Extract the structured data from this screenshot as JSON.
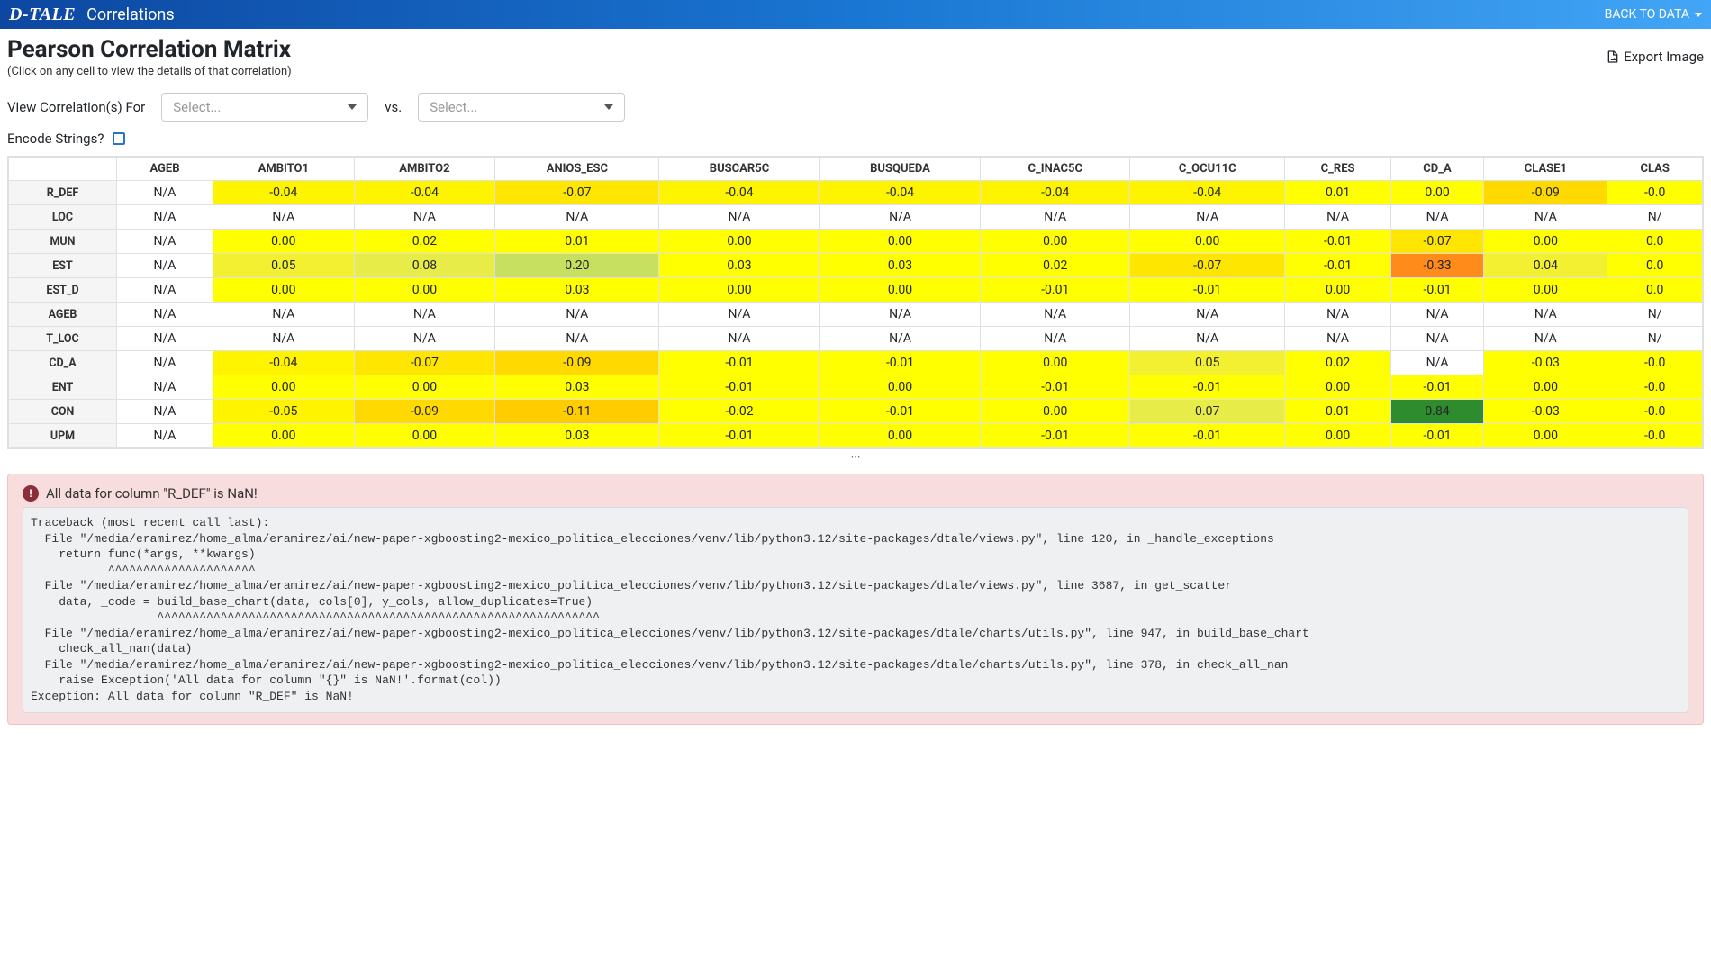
{
  "nav": {
    "logo": "D-TALE",
    "title": "Correlations",
    "back": "BACK TO DATA"
  },
  "header": {
    "title": "Pearson Correlation Matrix",
    "subtitle": "(Click on any cell to view the details of that correlation)",
    "export": "Export Image"
  },
  "controls": {
    "view_label": "View Correlation(s) For",
    "select1_placeholder": "Select...",
    "vs_label": "vs.",
    "select2_placeholder": "Select...",
    "encode_label": "Encode Strings?"
  },
  "table": {
    "col_headers": [
      "AGEB",
      "AMBITO1",
      "AMBITO2",
      "ANIOS_ESC",
      "BUSCAR5C",
      "BUSQUEDA",
      "C_INAC5C",
      "C_OCU11C",
      "C_RES",
      "CD_A",
      "CLASE1",
      "CLAS"
    ],
    "row_headers": [
      "R_DEF",
      "LOC",
      "MUN",
      "EST",
      "EST_D",
      "AGEB",
      "T_LOC",
      "CD_A",
      "ENT",
      "CON",
      "UPM"
    ],
    "cells": [
      [
        {
          "v": "N/A"
        },
        {
          "v": "-0.04"
        },
        {
          "v": "-0.04"
        },
        {
          "v": "-0.07"
        },
        {
          "v": "-0.04"
        },
        {
          "v": "-0.04"
        },
        {
          "v": "-0.04"
        },
        {
          "v": "-0.04"
        },
        {
          "v": "0.01"
        },
        {
          "v": "0.00"
        },
        {
          "v": "-0.09"
        },
        {
          "v": "-0.0"
        }
      ],
      [
        {
          "v": "N/A"
        },
        {
          "v": "N/A"
        },
        {
          "v": "N/A"
        },
        {
          "v": "N/A"
        },
        {
          "v": "N/A"
        },
        {
          "v": "N/A"
        },
        {
          "v": "N/A"
        },
        {
          "v": "N/A"
        },
        {
          "v": "N/A"
        },
        {
          "v": "N/A"
        },
        {
          "v": "N/A"
        },
        {
          "v": "N/"
        }
      ],
      [
        {
          "v": "N/A"
        },
        {
          "v": "0.00"
        },
        {
          "v": "0.02"
        },
        {
          "v": "0.01"
        },
        {
          "v": "0.00"
        },
        {
          "v": "0.00"
        },
        {
          "v": "0.00"
        },
        {
          "v": "0.00"
        },
        {
          "v": "-0.01"
        },
        {
          "v": "-0.07"
        },
        {
          "v": "0.00"
        },
        {
          "v": "0.0"
        }
      ],
      [
        {
          "v": "N/A"
        },
        {
          "v": "0.05"
        },
        {
          "v": "0.08"
        },
        {
          "v": "0.20"
        },
        {
          "v": "0.03"
        },
        {
          "v": "0.03"
        },
        {
          "v": "0.02"
        },
        {
          "v": "-0.07"
        },
        {
          "v": "-0.01"
        },
        {
          "v": "-0.33"
        },
        {
          "v": "0.04"
        },
        {
          "v": "0.0"
        }
      ],
      [
        {
          "v": "N/A"
        },
        {
          "v": "0.00"
        },
        {
          "v": "0.00"
        },
        {
          "v": "0.03"
        },
        {
          "v": "0.00"
        },
        {
          "v": "0.00"
        },
        {
          "v": "-0.01"
        },
        {
          "v": "-0.01"
        },
        {
          "v": "0.00"
        },
        {
          "v": "-0.01"
        },
        {
          "v": "0.00"
        },
        {
          "v": "0.0"
        }
      ],
      [
        {
          "v": "N/A"
        },
        {
          "v": "N/A"
        },
        {
          "v": "N/A"
        },
        {
          "v": "N/A"
        },
        {
          "v": "N/A"
        },
        {
          "v": "N/A"
        },
        {
          "v": "N/A"
        },
        {
          "v": "N/A"
        },
        {
          "v": "N/A"
        },
        {
          "v": "N/A"
        },
        {
          "v": "N/A"
        },
        {
          "v": "N/"
        }
      ],
      [
        {
          "v": "N/A"
        },
        {
          "v": "N/A"
        },
        {
          "v": "N/A"
        },
        {
          "v": "N/A"
        },
        {
          "v": "N/A"
        },
        {
          "v": "N/A"
        },
        {
          "v": "N/A"
        },
        {
          "v": "N/A"
        },
        {
          "v": "N/A"
        },
        {
          "v": "N/A"
        },
        {
          "v": "N/A"
        },
        {
          "v": "N/"
        }
      ],
      [
        {
          "v": "N/A"
        },
        {
          "v": "-0.04"
        },
        {
          "v": "-0.07"
        },
        {
          "v": "-0.09"
        },
        {
          "v": "-0.01"
        },
        {
          "v": "-0.01"
        },
        {
          "v": "0.00"
        },
        {
          "v": "0.05"
        },
        {
          "v": "0.02"
        },
        {
          "v": "N/A"
        },
        {
          "v": "-0.03"
        },
        {
          "v": "-0.0"
        }
      ],
      [
        {
          "v": "N/A"
        },
        {
          "v": "0.00"
        },
        {
          "v": "0.00"
        },
        {
          "v": "0.03"
        },
        {
          "v": "-0.01"
        },
        {
          "v": "0.00"
        },
        {
          "v": "-0.01"
        },
        {
          "v": "-0.01"
        },
        {
          "v": "0.00"
        },
        {
          "v": "-0.01"
        },
        {
          "v": "0.00"
        },
        {
          "v": "-0.0"
        }
      ],
      [
        {
          "v": "N/A"
        },
        {
          "v": "-0.05"
        },
        {
          "v": "-0.09"
        },
        {
          "v": "-0.11"
        },
        {
          "v": "-0.02"
        },
        {
          "v": "-0.01"
        },
        {
          "v": "0.00"
        },
        {
          "v": "0.07"
        },
        {
          "v": "0.01"
        },
        {
          "v": "0.84"
        },
        {
          "v": "-0.03"
        },
        {
          "v": "-0.0"
        }
      ],
      [
        {
          "v": "N/A"
        },
        {
          "v": "0.00"
        },
        {
          "v": "0.00"
        },
        {
          "v": "0.03"
        },
        {
          "v": "-0.01"
        },
        {
          "v": "0.00"
        },
        {
          "v": "-0.01"
        },
        {
          "v": "-0.01"
        },
        {
          "v": "0.00"
        },
        {
          "v": "-0.01"
        },
        {
          "v": "0.00"
        },
        {
          "v": "-0.0"
        }
      ]
    ]
  },
  "error": {
    "title": "All data for column \"R_DEF\" is NaN!",
    "traceback": "Traceback (most recent call last):\n  File \"/media/eramirez/home_alma/eramirez/ai/new-paper-xgboosting2-mexico_politica_elecciones/venv/lib/python3.12/site-packages/dtale/views.py\", line 120, in _handle_exceptions\n    return func(*args, **kwargs)\n           ^^^^^^^^^^^^^^^^^^^^^\n  File \"/media/eramirez/home_alma/eramirez/ai/new-paper-xgboosting2-mexico_politica_elecciones/venv/lib/python3.12/site-packages/dtale/views.py\", line 3687, in get_scatter\n    data, _code = build_base_chart(data, cols[0], y_cols, allow_duplicates=True)\n                  ^^^^^^^^^^^^^^^^^^^^^^^^^^^^^^^^^^^^^^^^^^^^^^^^^^^^^^^^^^^^^^^\n  File \"/media/eramirez/home_alma/eramirez/ai/new-paper-xgboosting2-mexico_politica_elecciones/venv/lib/python3.12/site-packages/dtale/charts/utils.py\", line 947, in build_base_chart\n    check_all_nan(data)\n  File \"/media/eramirez/home_alma/eramirez/ai/new-paper-xgboosting2-mexico_politica_elecciones/venv/lib/python3.12/site-packages/dtale/charts/utils.py\", line 378, in check_all_nan\n    raise Exception('All data for column \"{}\" is NaN!'.format(col))\nException: All data for column \"R_DEF\" is NaN!"
  },
  "chart_data": {
    "type": "heatmap",
    "title": "Pearson Correlation Matrix",
    "row_labels": [
      "R_DEF",
      "LOC",
      "MUN",
      "EST",
      "EST_D",
      "AGEB",
      "T_LOC",
      "CD_A",
      "ENT",
      "CON",
      "UPM"
    ],
    "col_labels": [
      "AGEB",
      "AMBITO1",
      "AMBITO2",
      "ANIOS_ESC",
      "BUSCAR5C",
      "BUSQUEDA",
      "C_INAC5C",
      "C_OCU11C",
      "C_RES",
      "CD_A",
      "CLASE1"
    ],
    "matrix": [
      [
        null,
        -0.04,
        -0.04,
        -0.07,
        -0.04,
        -0.04,
        -0.04,
        -0.04,
        0.01,
        0.0,
        -0.09
      ],
      [
        null,
        null,
        null,
        null,
        null,
        null,
        null,
        null,
        null,
        null,
        null
      ],
      [
        null,
        0.0,
        0.02,
        0.01,
        0.0,
        0.0,
        0.0,
        0.0,
        -0.01,
        -0.07,
        0.0
      ],
      [
        null,
        0.05,
        0.08,
        0.2,
        0.03,
        0.03,
        0.02,
        -0.07,
        -0.01,
        -0.33,
        0.04
      ],
      [
        null,
        0.0,
        0.0,
        0.03,
        0.0,
        0.0,
        -0.01,
        -0.01,
        0.0,
        -0.01,
        0.0
      ],
      [
        null,
        null,
        null,
        null,
        null,
        null,
        null,
        null,
        null,
        null,
        null
      ],
      [
        null,
        null,
        null,
        null,
        null,
        null,
        null,
        null,
        null,
        null,
        null
      ],
      [
        null,
        -0.04,
        -0.07,
        -0.09,
        -0.01,
        -0.01,
        0.0,
        0.05,
        0.02,
        null,
        -0.03
      ],
      [
        null,
        0.0,
        0.0,
        0.03,
        -0.01,
        0.0,
        -0.01,
        -0.01,
        0.0,
        -0.01,
        0.0
      ],
      [
        null,
        -0.05,
        -0.09,
        -0.11,
        -0.02,
        -0.01,
        0.0,
        0.07,
        0.01,
        0.84,
        -0.03
      ],
      [
        null,
        0.0,
        0.0,
        0.03,
        -0.01,
        0.0,
        -0.01,
        -0.01,
        0.0,
        -0.01,
        0.0
      ]
    ],
    "color_range": [
      -1,
      1
    ]
  }
}
